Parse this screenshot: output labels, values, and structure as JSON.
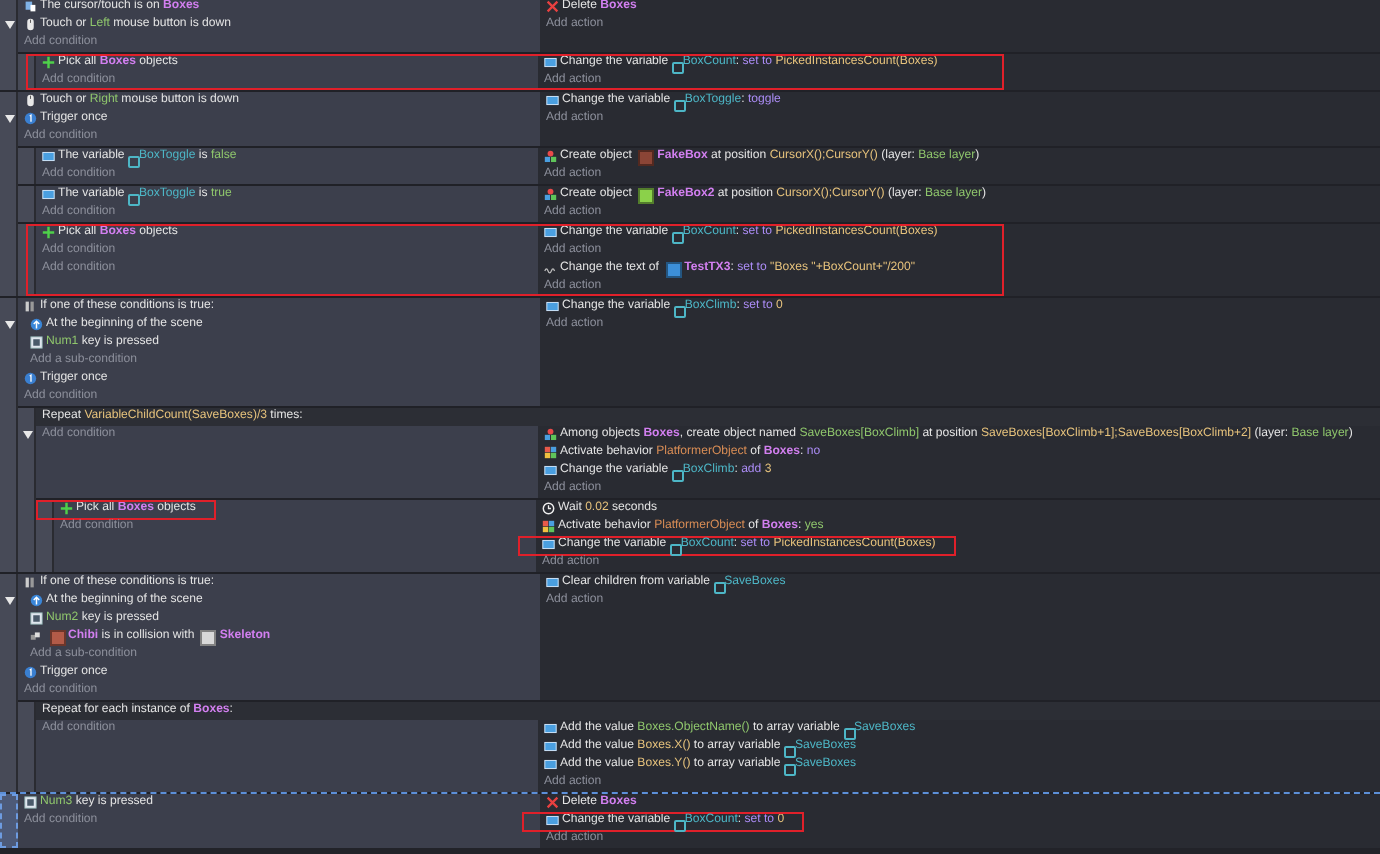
{
  "events": [
    {
      "kind": "standard",
      "selected": false,
      "highlighted": false,
      "conditions": [
        {
          "kind": "cursor",
          "highlighted": false,
          "parts": [
            "The cursor/touch is on ",
            {
              "text": "Boxes",
              "kind": "object"
            }
          ]
        },
        {
          "kind": "mouse",
          "highlighted": false,
          "parts": [
            "Touch or ",
            {
              "text": "Left",
              "kind": "literal"
            },
            " mouse button is down"
          ]
        },
        {
          "kind": "add",
          "highlighted": false,
          "parts": [
            "Add condition"
          ]
        }
      ],
      "actions": [
        {
          "kind": "delete",
          "highlighted": false,
          "parts": [
            "Delete ",
            {
              "text": "Boxes",
              "kind": "object"
            }
          ]
        },
        {
          "kind": "add",
          "highlighted": false,
          "parts": [
            "Add action"
          ]
        }
      ],
      "children": [
        {
          "kind": "standard",
          "selected": false,
          "highlighted": true,
          "conditions": [
            {
              "kind": "pick",
              "highlighted": false,
              "parts": [
                "Pick all ",
                {
                  "text": "Boxes",
                  "kind": "object"
                },
                " objects"
              ]
            },
            {
              "kind": "add",
              "highlighted": false,
              "parts": [
                "Add condition"
              ]
            }
          ],
          "actions": [
            {
              "kind": "variable",
              "highlighted": false,
              "parts": [
                "Change the variable ",
                {
                  "text": "BoxCount",
                  "kind": "variable"
                },
                ": ",
                {
                  "text": "set to ",
                  "kind": "operator"
                },
                {
                  "text": "PickedInstancesCount(Boxes)",
                  "kind": "expression"
                }
              ]
            },
            {
              "kind": "add",
              "highlighted": false,
              "parts": [
                "Add action"
              ]
            }
          ]
        }
      ]
    },
    {
      "kind": "standard",
      "selected": false,
      "highlighted": false,
      "conditions": [
        {
          "kind": "mouse",
          "highlighted": false,
          "parts": [
            "Touch or ",
            {
              "text": "Right",
              "kind": "literal"
            },
            " mouse button is down"
          ]
        },
        {
          "kind": "trigger",
          "highlighted": false,
          "parts": [
            "Trigger once"
          ]
        },
        {
          "kind": "add",
          "highlighted": false,
          "parts": [
            "Add condition"
          ]
        }
      ],
      "actions": [
        {
          "kind": "variable",
          "highlighted": false,
          "parts": [
            "Change the variable ",
            {
              "text": "BoxToggle",
              "kind": "variable"
            },
            ": ",
            {
              "text": "toggle",
              "kind": "operator"
            }
          ]
        },
        {
          "kind": "add",
          "highlighted": false,
          "parts": [
            "Add action"
          ]
        }
      ],
      "children": [
        {
          "kind": "standard",
          "selected": false,
          "highlighted": false,
          "conditions": [
            {
              "kind": "variable",
              "highlighted": false,
              "parts": [
                "The variable ",
                {
                  "text": "BoxToggle",
                  "kind": "variable"
                },
                " is ",
                {
                  "text": "false",
                  "kind": "literal"
                }
              ]
            },
            {
              "kind": "add",
              "highlighted": false,
              "parts": [
                "Add condition"
              ]
            }
          ],
          "actions": [
            {
              "kind": "create",
              "highlighted": false,
              "parts": [
                "Create object ",
                {
                  "text": "FakeBox",
                  "kind": "object",
                  "color": "#8b4536"
                },
                " at position ",
                {
                  "text": "CursorX();CursorY()",
                  "kind": "expression"
                },
                " (layer: ",
                {
                  "text": "Base layer",
                  "kind": "literal"
                },
                ")"
              ]
            },
            {
              "kind": "add",
              "highlighted": false,
              "parts": [
                "Add action"
              ]
            }
          ]
        },
        {
          "kind": "standard",
          "selected": false,
          "highlighted": false,
          "conditions": [
            {
              "kind": "variable",
              "highlighted": false,
              "parts": [
                "The variable ",
                {
                  "text": "BoxToggle",
                  "kind": "variable"
                },
                " is ",
                {
                  "text": "true",
                  "kind": "literal"
                }
              ]
            },
            {
              "kind": "add",
              "highlighted": false,
              "parts": [
                "Add condition"
              ]
            }
          ],
          "actions": [
            {
              "kind": "create",
              "highlighted": false,
              "parts": [
                "Create object ",
                {
                  "text": "FakeBox2",
                  "kind": "object",
                  "color": "#8bd14a"
                },
                " at position ",
                {
                  "text": "CursorX();CursorY()",
                  "kind": "expression"
                },
                " (layer: ",
                {
                  "text": "Base layer",
                  "kind": "literal"
                },
                ")"
              ]
            },
            {
              "kind": "add",
              "highlighted": false,
              "parts": [
                "Add action"
              ]
            }
          ]
        },
        {
          "kind": "standard",
          "selected": false,
          "highlighted": true,
          "conditions": [
            {
              "kind": "pick",
              "highlighted": false,
              "parts": [
                "Pick all ",
                {
                  "text": "Boxes",
                  "kind": "object"
                },
                " objects"
              ]
            },
            {
              "kind": "add",
              "highlighted": false,
              "parts": [
                "Add condition"
              ]
            },
            {
              "kind": "add",
              "highlighted": false,
              "parts": [
                "Add condition"
              ]
            }
          ],
          "actions": [
            {
              "kind": "variable",
              "highlighted": false,
              "parts": [
                "Change the variable ",
                {
                  "text": "BoxCount",
                  "kind": "variable"
                },
                ": ",
                {
                  "text": "set to ",
                  "kind": "operator"
                },
                {
                  "text": "PickedInstancesCount(Boxes)",
                  "kind": "expression"
                }
              ]
            },
            {
              "kind": "add",
              "highlighted": false,
              "parts": [
                "Add action"
              ]
            },
            {
              "kind": "text",
              "highlighted": false,
              "parts": [
                "Change the text of ",
                {
                  "text": "TestTX3",
                  "kind": "object",
                  "color": "#3c8fd8"
                },
                ": ",
                {
                  "text": "set to ",
                  "kind": "operator"
                },
                {
                  "text": "\"Boxes \"+BoxCount+\"/200\"",
                  "kind": "expression"
                }
              ]
            },
            {
              "kind": "add",
              "highlighted": false,
              "parts": [
                "Add action"
              ]
            }
          ]
        }
      ]
    },
    {
      "kind": "standard",
      "selected": false,
      "highlighted": false,
      "conditions": [
        {
          "kind": "any-of",
          "highlighted": false,
          "parts": [
            "If one of these conditions is true:"
          ],
          "children": [
            {
              "kind": "scene-start",
              "highlighted": false,
              "parts": [
                "At the beginning of the scene"
              ]
            },
            {
              "kind": "key",
              "highlighted": false,
              "parts": [
                {
                  "text": "Num1",
                  "kind": "literal"
                },
                " key is pressed"
              ]
            },
            {
              "kind": "add",
              "highlighted": false,
              "parts": [
                "Add a sub-condition"
              ]
            }
          ]
        },
        {
          "kind": "trigger",
          "highlighted": false,
          "parts": [
            "Trigger once"
          ]
        },
        {
          "kind": "add",
          "highlighted": false,
          "parts": [
            "Add condition"
          ]
        }
      ],
      "actions": [
        {
          "kind": "variable",
          "highlighted": false,
          "parts": [
            "Change the variable ",
            {
              "text": "BoxClimb",
              "kind": "variable"
            },
            ": ",
            {
              "text": "set to ",
              "kind": "operator"
            },
            {
              "text": "0",
              "kind": "expression"
            }
          ]
        },
        {
          "kind": "add",
          "highlighted": false,
          "parts": [
            "Add action"
          ]
        }
      ],
      "children": [
        {
          "kind": "repeat",
          "selected": false,
          "highlighted": false,
          "header": [
            "Repeat ",
            {
              "text": "VariableChildCount(SaveBoxes)/3",
              "kind": "expression"
            },
            " times:"
          ],
          "conditions": [
            {
              "kind": "add",
              "highlighted": false,
              "parts": [
                "Add condition"
              ]
            }
          ],
          "actions": [
            {
              "kind": "create",
              "highlighted": false,
              "parts": [
                "Among objects ",
                {
                  "text": "Boxes",
                  "kind": "object"
                },
                ", create object named ",
                {
                  "text": "SaveBoxes[BoxClimb]",
                  "kind": "literal"
                },
                " at position ",
                {
                  "text": "SaveBoxes[BoxClimb+1];SaveBoxes[BoxClimb+2]",
                  "kind": "expression"
                },
                " (layer: ",
                {
                  "text": "Base layer",
                  "kind": "literal"
                },
                ")"
              ]
            },
            {
              "kind": "behavior",
              "highlighted": false,
              "parts": [
                "Activate behavior ",
                {
                  "text": "PlatformerObject",
                  "kind": "behavior"
                },
                " of ",
                {
                  "text": "Boxes",
                  "kind": "object"
                },
                ": ",
                {
                  "text": "no",
                  "kind": "operator"
                }
              ]
            },
            {
              "kind": "variable",
              "highlighted": false,
              "parts": [
                "Change the variable ",
                {
                  "text": "BoxClimb",
                  "kind": "variable"
                },
                ": ",
                {
                  "text": "add ",
                  "kind": "operator"
                },
                {
                  "text": "3",
                  "kind": "expression"
                }
              ]
            },
            {
              "kind": "add",
              "highlighted": false,
              "parts": [
                "Add action"
              ]
            }
          ],
          "children": [
            {
              "kind": "standard",
              "selected": false,
              "highlighted": false,
              "conditions": [
                {
                  "kind": "pick",
                  "highlighted": true,
                  "parts": [
                    "Pick all ",
                    {
                      "text": "Boxes",
                      "kind": "object"
                    },
                    " objects"
                  ]
                },
                {
                  "kind": "add",
                  "highlighted": false,
                  "parts": [
                    "Add condition"
                  ]
                }
              ],
              "actions": [
                {
                  "kind": "wait",
                  "highlighted": false,
                  "parts": [
                    "Wait ",
                    {
                      "text": "0.02",
                      "kind": "expression"
                    },
                    " seconds"
                  ]
                },
                {
                  "kind": "behavior",
                  "highlighted": false,
                  "parts": [
                    "Activate behavior ",
                    {
                      "text": "PlatformerObject",
                      "kind": "behavior"
                    },
                    " of ",
                    {
                      "text": "Boxes",
                      "kind": "object"
                    },
                    ": ",
                    {
                      "text": "yes",
                      "kind": "literal"
                    }
                  ]
                },
                {
                  "kind": "variable",
                  "highlighted": true,
                  "parts": [
                    "Change the variable ",
                    {
                      "text": "BoxCount",
                      "kind": "variable"
                    },
                    ": ",
                    {
                      "text": "set to ",
                      "kind": "operator"
                    },
                    {
                      "text": "PickedInstancesCount(Boxes)",
                      "kind": "expression"
                    }
                  ]
                },
                {
                  "kind": "add",
                  "highlighted": false,
                  "parts": [
                    "Add action"
                  ]
                }
              ]
            }
          ]
        }
      ]
    },
    {
      "kind": "standard",
      "selected": false,
      "highlighted": false,
      "conditions": [
        {
          "kind": "any-of",
          "highlighted": false,
          "parts": [
            "If one of these conditions is true:"
          ],
          "children": [
            {
              "kind": "scene-start",
              "highlighted": false,
              "parts": [
                "At the beginning of the scene"
              ]
            },
            {
              "kind": "key",
              "highlighted": false,
              "parts": [
                {
                  "text": "Num2",
                  "kind": "literal"
                },
                " key is pressed"
              ]
            },
            {
              "kind": "collision",
              "highlighted": false,
              "parts": [
                {
                  "text": "Chibi",
                  "kind": "object",
                  "color": "#b35b48"
                },
                " is in collision with ",
                {
                  "text": "Skeleton",
                  "kind": "object",
                  "color": "#d9d9d9"
                }
              ]
            },
            {
              "kind": "add",
              "highlighted": false,
              "parts": [
                "Add a sub-condition"
              ]
            }
          ]
        },
        {
          "kind": "trigger",
          "highlighted": false,
          "parts": [
            "Trigger once"
          ]
        },
        {
          "kind": "add",
          "highlighted": false,
          "parts": [
            "Add condition"
          ]
        }
      ],
      "actions": [
        {
          "kind": "variable",
          "highlighted": false,
          "parts": [
            "Clear children from variable ",
            {
              "text": "SaveBoxes",
              "kind": "variable"
            }
          ]
        },
        {
          "kind": "add",
          "highlighted": false,
          "parts": [
            "Add action"
          ]
        }
      ],
      "children": [
        {
          "kind": "repeat",
          "selected": false,
          "highlighted": false,
          "header": [
            "Repeat for each instance of ",
            {
              "text": "Boxes",
              "kind": "object"
            },
            ":"
          ],
          "conditions": [
            {
              "kind": "add",
              "highlighted": false,
              "parts": [
                "Add condition"
              ]
            }
          ],
          "actions": [
            {
              "kind": "variable",
              "highlighted": false,
              "parts": [
                "Add the value ",
                {
                  "text": "Boxes.ObjectName()",
                  "kind": "literal"
                },
                " to array variable ",
                {
                  "text": "SaveBoxes",
                  "kind": "variable"
                }
              ]
            },
            {
              "kind": "variable",
              "highlighted": false,
              "parts": [
                "Add the value ",
                {
                  "text": "Boxes.X()",
                  "kind": "expression"
                },
                " to array variable ",
                {
                  "text": "SaveBoxes",
                  "kind": "variable"
                }
              ]
            },
            {
              "kind": "variable",
              "highlighted": false,
              "parts": [
                "Add the value ",
                {
                  "text": "Boxes.Y()",
                  "kind": "expression"
                },
                " to array variable ",
                {
                  "text": "SaveBoxes",
                  "kind": "variable"
                }
              ]
            },
            {
              "kind": "add",
              "highlighted": false,
              "parts": [
                "Add action"
              ]
            }
          ]
        }
      ]
    },
    {
      "kind": "standard",
      "selected": true,
      "highlighted": false,
      "conditions": [
        {
          "kind": "key",
          "highlighted": false,
          "parts": [
            {
              "text": "Num3",
              "kind": "literal"
            },
            " key is pressed"
          ]
        },
        {
          "kind": "add",
          "highlighted": false,
          "parts": [
            "Add condition"
          ]
        }
      ],
      "actions": [
        {
          "kind": "delete",
          "highlighted": false,
          "parts": [
            "Delete ",
            {
              "text": "Boxes",
              "kind": "object"
            }
          ]
        },
        {
          "kind": "variable",
          "highlighted": true,
          "parts": [
            "Change the variable ",
            {
              "text": "BoxCount",
              "kind": "variable"
            },
            ": ",
            {
              "text": "set to ",
              "kind": "operator"
            },
            {
              "text": "0",
              "kind": "expression"
            }
          ]
        },
        {
          "kind": "add",
          "highlighted": false,
          "parts": [
            "Add action"
          ]
        }
      ]
    }
  ]
}
